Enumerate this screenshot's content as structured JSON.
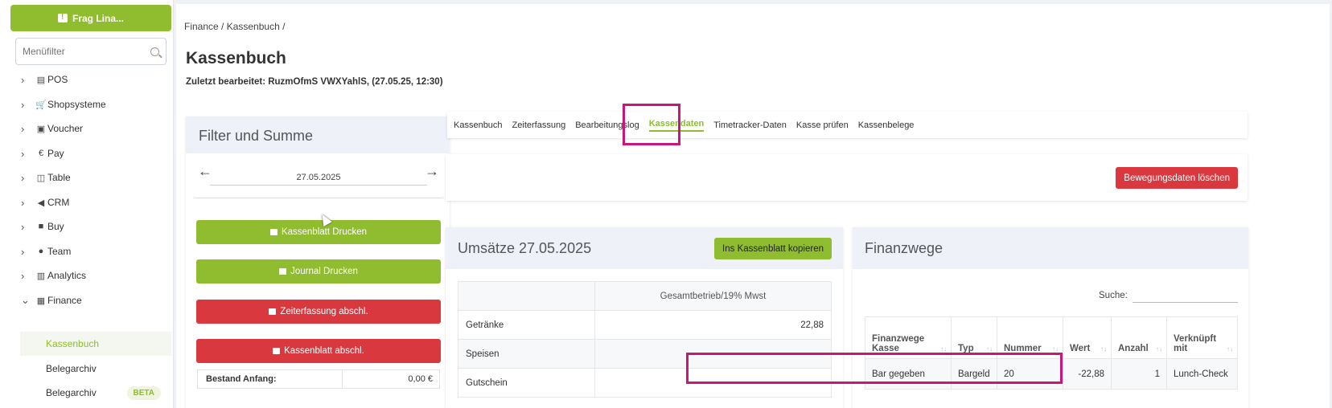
{
  "sidebar": {
    "ask_label": "Frag Lina...",
    "filter_placeholder": "Menüfilter",
    "items": [
      {
        "label": "POS",
        "icon": "register-icon"
      },
      {
        "label": "Shopsysteme",
        "icon": "cart-icon"
      },
      {
        "label": "Voucher",
        "icon": "gift-icon"
      },
      {
        "label": "Pay",
        "icon": "euro-icon"
      },
      {
        "label": "Table",
        "icon": "book-icon"
      },
      {
        "label": "CRM",
        "icon": "megaphone-icon"
      },
      {
        "label": "Buy",
        "icon": "truck-icon"
      },
      {
        "label": "Team",
        "icon": "users-icon"
      },
      {
        "label": "Analytics",
        "icon": "chart-icon"
      },
      {
        "label": "Finance",
        "icon": "calculator-icon"
      }
    ],
    "sub_items": [
      {
        "label": "Kassenbuch",
        "active": true
      },
      {
        "label": "Belegarchiv"
      },
      {
        "label": "Belegarchiv",
        "badge": "BETA"
      }
    ]
  },
  "breadcrumb": "Finance  /  Kassenbuch  /",
  "page": {
    "title": "Kassenbuch",
    "last_edit": "Zuletzt bearbeitet: RuzmOfmS VWXYahlS, (27.05.25, 12:30)"
  },
  "filter": {
    "title": "Filter und Summe",
    "date": "27.05.2025",
    "buttons": {
      "print_sheet": "Kassenblatt Drucken",
      "print_journal": "Journal Drucken",
      "close_time": "Zeiterfassung abschl.",
      "close_sheet": "Kassenblatt abschl."
    },
    "bestand_label": "Bestand Anfang:",
    "bestand_value": "0,00 €"
  },
  "tabs": [
    "Kassenbuch",
    "Zeiterfassung",
    "Bearbeitungslog",
    "Kassendaten",
    "Timetracker-Daten",
    "Kasse prüfen",
    "Kassenbelege"
  ],
  "active_tab": "Kassendaten",
  "delete_label": "Bewegungsdaten löschen",
  "umsaetze": {
    "title": "Umsätze 27.05.2025",
    "copy_label": "Ins Kassenblatt kopieren",
    "column": "Gesamtbetrieb/19% Mwst",
    "rows": [
      {
        "label": "Getränke",
        "value": "22,88"
      },
      {
        "label": "Speisen",
        "value": ""
      },
      {
        "label": "Gutschein",
        "value": ""
      }
    ]
  },
  "finanzwege": {
    "title": "Finanzwege",
    "search_label": "Suche:",
    "headers": [
      "Finanzwege Kasse",
      "Typ",
      "Nummer",
      "Wert",
      "Anzahl",
      "Verknüpft mit"
    ],
    "row": [
      "Bar gegeben",
      "Bargeld",
      "20",
      "-22,88",
      "1",
      "Lunch-Check"
    ]
  },
  "colors": {
    "accent": "#8fbd2f",
    "danger": "#d9383f",
    "highlight": "#c8177b"
  }
}
